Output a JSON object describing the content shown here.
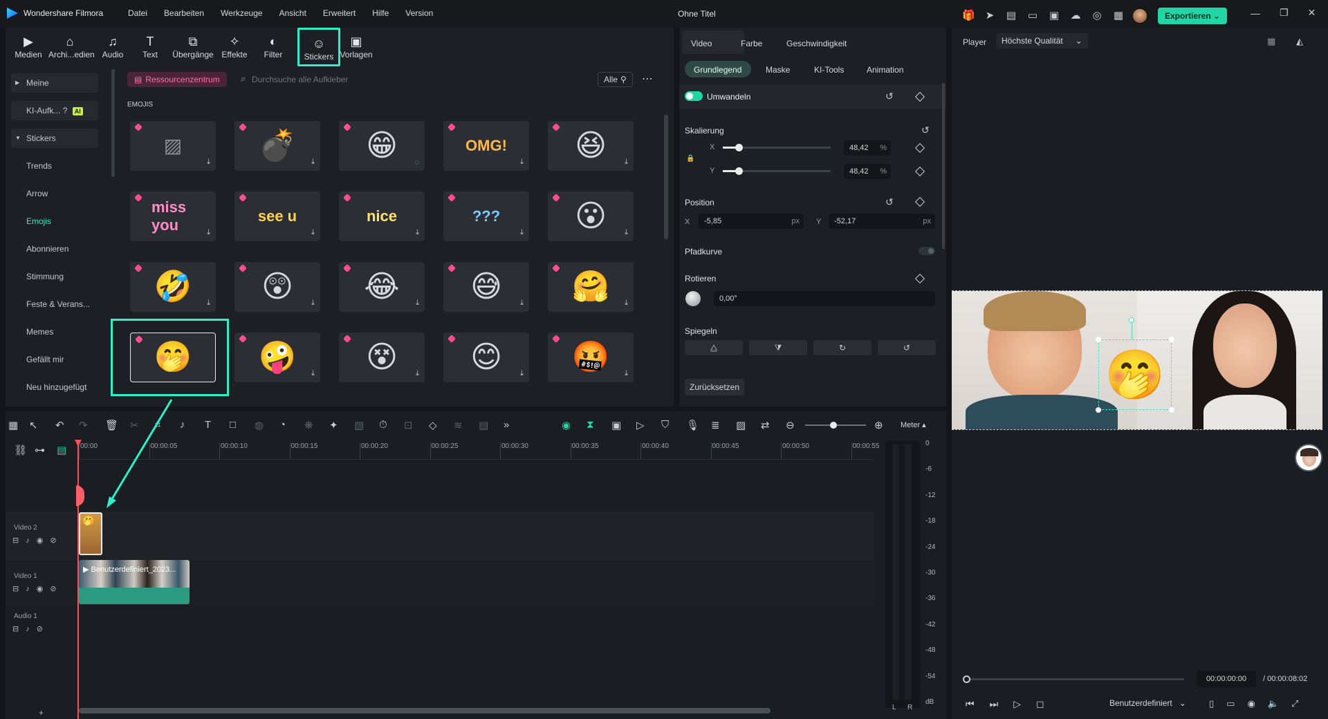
{
  "app": {
    "name": "Wondershare Filmora",
    "project_title": "Ohne Titel",
    "menu": [
      "Datei",
      "Bearbeiten",
      "Werkzeuge",
      "Ansicht",
      "Erweitert",
      "Hilfe",
      "Version"
    ],
    "export_label": "Exportieren"
  },
  "toolbar": {
    "items": [
      "Medien",
      "Archi...edien",
      "Audio",
      "Text",
      "Übergänge",
      "Effekte",
      "Filter",
      "Stickers",
      "Vorlagen"
    ],
    "active": "Stickers"
  },
  "library": {
    "sidebar": {
      "meine": "Meine",
      "ki": "KI-Aufk...",
      "ai_badge": "AI",
      "stickers": "Stickers",
      "items": [
        "Trends",
        "Arrow",
        "Emojis",
        "Abonnieren",
        "Stimmung",
        "Feste & Verans...",
        "Memes",
        "Gefällt mir",
        "Neu hinzugefügt"
      ],
      "active": "Emojis"
    },
    "resource_center": "Ressourcenzentrum",
    "search_placeholder": "Durchsuche alle Aufkleber",
    "filter_label": "Alle",
    "section": "EMOJIS",
    "stickers": [
      {
        "kind": "placeholder"
      },
      {
        "kind": "emoji",
        "glyph": "💣"
      },
      {
        "kind": "emoji",
        "glyph": "😁"
      },
      {
        "kind": "word",
        "text": "OMG!",
        "color": "#ffb84d"
      },
      {
        "kind": "emoji",
        "glyph": "😆"
      },
      {
        "kind": "word",
        "text": "miss you",
        "color": "#ff8cc6"
      },
      {
        "kind": "word",
        "text": "see u",
        "color": "#ffd24d"
      },
      {
        "kind": "word",
        "text": "nice",
        "color": "#ffe36b"
      },
      {
        "kind": "word",
        "text": "???",
        "color": "#7ec8ff"
      },
      {
        "kind": "emoji",
        "glyph": "😮"
      },
      {
        "kind": "emoji",
        "glyph": "🤣"
      },
      {
        "kind": "emoji",
        "glyph": "😲"
      },
      {
        "kind": "emoji",
        "glyph": "😂"
      },
      {
        "kind": "emoji",
        "glyph": "😅"
      },
      {
        "kind": "emoji",
        "glyph": "🤗"
      },
      {
        "kind": "emoji",
        "glyph": "🤭"
      },
      {
        "kind": "emoji",
        "glyph": "🤪"
      },
      {
        "kind": "emoji",
        "glyph": "😵"
      },
      {
        "kind": "emoji",
        "glyph": "😊"
      },
      {
        "kind": "emoji",
        "glyph": "🤬"
      }
    ]
  },
  "properties": {
    "main_tabs": [
      "Video",
      "Farbe",
      "Geschwindigkeit"
    ],
    "sub_tabs": [
      "Grundlegend",
      "Maske",
      "KI-Tools",
      "Animation"
    ],
    "transform_label": "Umwandeln",
    "scale_label": "Skalierung",
    "scale_x": "48,42",
    "scale_y": "48,42",
    "percent": "%",
    "axis_x": "X",
    "axis_y": "Y",
    "position_label": "Position",
    "pos_x": "-5,85",
    "pos_y": "-52,17",
    "px": "px",
    "path_curve_label": "Pfadkurve",
    "rotate_label": "Rotieren",
    "rotate_value": "0,00°",
    "mirror_label": "Spiegeln",
    "reset_label": "Zurücksetzen"
  },
  "player": {
    "label": "Player",
    "quality": "Höchste Qualität",
    "current_time": "00:00:00:00",
    "total_time": "/ 00:00:08:02",
    "preset": "Benutzerdefiniert"
  },
  "timeline": {
    "meter_label": "Meter",
    "ruler": [
      "00:00",
      "00:00:05",
      "00:00:10",
      "00:00:15",
      "00:00:20",
      "00:00:25",
      "00:00:30",
      "00:00:35",
      "00:00:40",
      "00:00:45",
      "00:00:50",
      "00:00:55"
    ],
    "meter_scale": [
      "0",
      "-6",
      "-12",
      "-18",
      "-24",
      "-30",
      "-36",
      "-42",
      "-48",
      "-54",
      "dB"
    ],
    "meter_lr": [
      "L",
      "R"
    ],
    "tracks": [
      "Video 2",
      "Video 1",
      "Audio 1"
    ],
    "clip_name": "Benutzerdefiniert_2023..."
  }
}
